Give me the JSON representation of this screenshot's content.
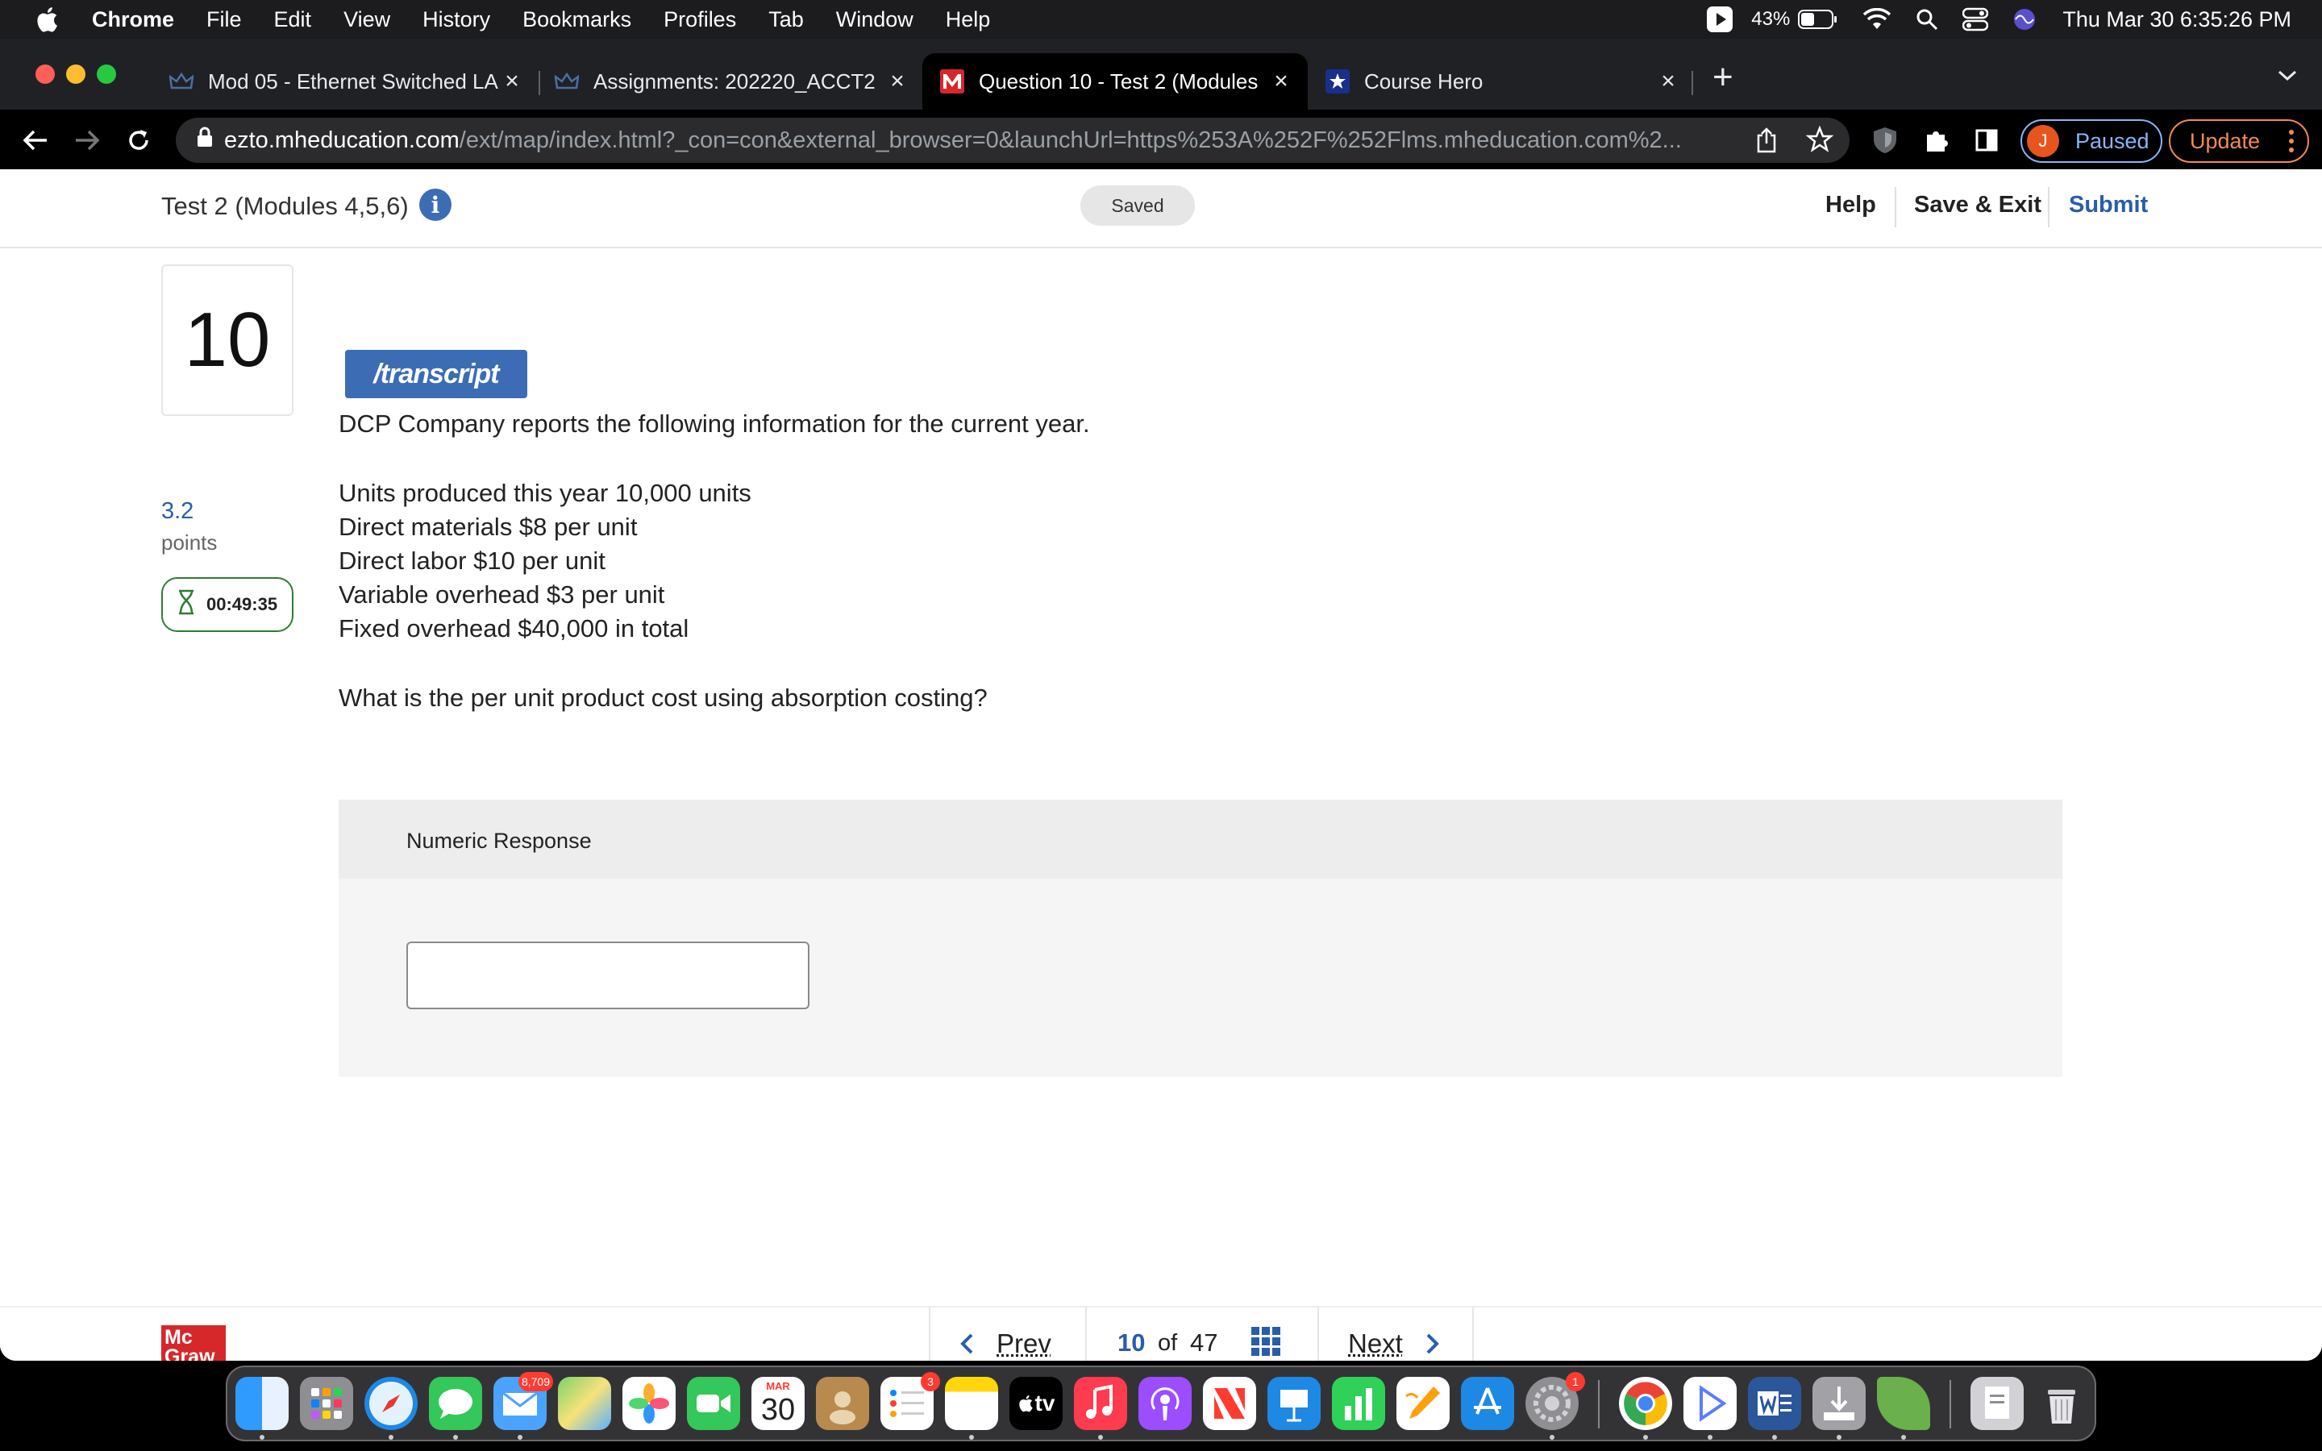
{
  "menubar": {
    "app": "Chrome",
    "items": [
      "File",
      "Edit",
      "View",
      "History",
      "Bookmarks",
      "Profiles",
      "Tab",
      "Window",
      "Help"
    ],
    "battery": "43%",
    "datetime": "Thu Mar 30  6:35:26 PM"
  },
  "tabs": [
    {
      "label": "Mod 05 - Ethernet Switched LA",
      "icon": "crown-icon"
    },
    {
      "label": "Assignments: 202220_ACCT2",
      "icon": "crown-icon"
    },
    {
      "label": "Question 10 - Test 2 (Modules",
      "icon": "mcgraw-m-icon",
      "active": true
    },
    {
      "label": "Course Hero",
      "icon": "star-icon"
    }
  ],
  "toolbar": {
    "url_host": "ezto.mheducation.com",
    "url_path": "/ext/map/index.html?_con=con&external_browser=0&launchUrl=https%253A%252F%252Flms.mheducation.com%2...",
    "profile_initial": "J",
    "profile_status": "Paused",
    "update_label": "Update"
  },
  "header": {
    "title": "Test 2 (Modules 4,5,6)",
    "saved": "Saved",
    "help": "Help",
    "save_exit": "Save & Exit",
    "submit": "Submit"
  },
  "question": {
    "number": "10",
    "points": "3.2",
    "points_label": "points",
    "timer": "00:49:35",
    "transcript_label": "/transcript",
    "intro": "DCP Company reports the following information for the current year.",
    "facts": [
      "Units produced this year 10,000 units",
      "Direct materials $8 per unit",
      "Direct labor $10 per unit",
      "Variable overhead $3 per unit",
      "Fixed overhead $40,000 in total"
    ],
    "prompt": "What is the per unit product cost using absorption costing?"
  },
  "response": {
    "label": "Numeric Response",
    "value": ""
  },
  "logo": {
    "text": "Mc Graw Hill"
  },
  "pager": {
    "prev": "Prev",
    "current": "10",
    "of": "of",
    "total": "47",
    "next": "Next"
  },
  "dock": {
    "mail_badge": "8,709",
    "calendar_month": "MAR",
    "calendar_day": "30",
    "reminders_badge": "3",
    "settings_badge": "1",
    "tv_label": "tv"
  }
}
